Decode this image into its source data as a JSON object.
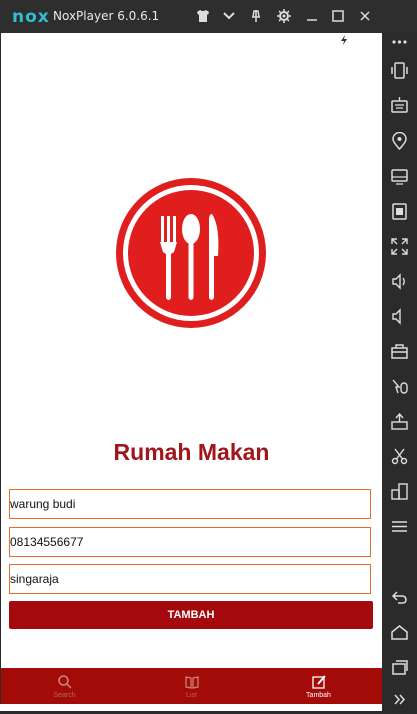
{
  "window": {
    "logo_text": "nox",
    "title": "NoxPlayer 6.0.6.1"
  },
  "app": {
    "name": "Rumah Makan",
    "fields": [
      {
        "value": "warung budi"
      },
      {
        "value": "08134556677"
      },
      {
        "value": "singaraja"
      }
    ],
    "submit_label": "TAMBAH",
    "nav": [
      {
        "label": "Search",
        "icon": "search-icon"
      },
      {
        "label": "List",
        "icon": "book-icon"
      },
      {
        "label": "Tambah",
        "icon": "edit-icon",
        "active": true
      }
    ]
  },
  "colors": {
    "primary": "#a4090d",
    "logo_red": "#e01e1e",
    "field_border": "#e0702a",
    "accent": "#2fbfd0"
  }
}
